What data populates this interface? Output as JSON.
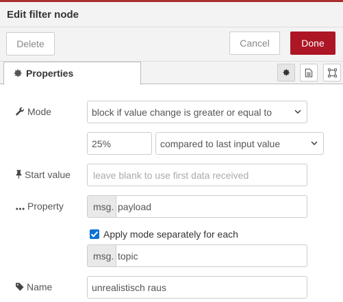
{
  "header": {
    "title": "Edit filter node"
  },
  "toolbar": {
    "delete_label": "Delete",
    "cancel_label": "Cancel",
    "done_label": "Done"
  },
  "tabs": {
    "properties_label": "Properties"
  },
  "form": {
    "mode": {
      "label": "Mode",
      "value": "block if value change is greater or equal to"
    },
    "threshold": {
      "value": "25%",
      "compare_value": "compared to last input value"
    },
    "start_value": {
      "label": "Start value",
      "placeholder": "leave blank to use first data received"
    },
    "property": {
      "label": "Property",
      "prefix": "msg.",
      "value": "payload"
    },
    "separately": {
      "checked": true,
      "label": "Apply mode separately for each"
    },
    "topic": {
      "prefix": "msg.",
      "value": "topic"
    },
    "name": {
      "label": "Name",
      "value": "unrealistisch raus"
    }
  },
  "colors": {
    "accent_red": "#ad1625",
    "checkbox_blue": "#0b73d4"
  }
}
